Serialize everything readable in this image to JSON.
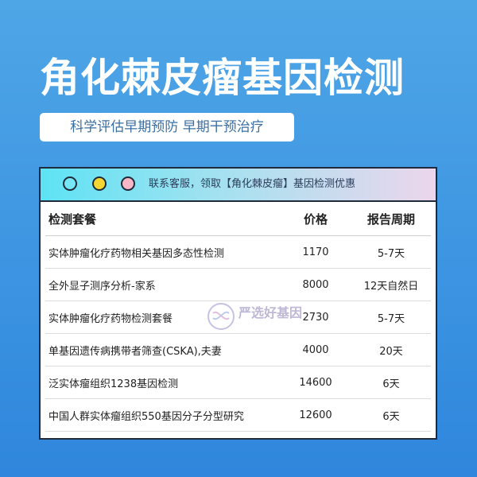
{
  "header": {
    "title": "角化棘皮瘤基因检测",
    "subtitle": "科学评估早期预防 早期干预治疗"
  },
  "window": {
    "bar_text": "联系客服，领取【角化棘皮瘤】基因检测优惠"
  },
  "table": {
    "columns": [
      "检测套餐",
      "价格",
      "报告周期"
    ],
    "rows": [
      {
        "name": "实体肿瘤化疗药物相关基因多态性检测",
        "price": "1170",
        "period": "5-7天"
      },
      {
        "name": "全外显子测序分析-家系",
        "price": "8000",
        "period": "12天自然日"
      },
      {
        "name": "实体肿瘤化疗药物检测套餐",
        "price": "2730",
        "period": "5-7天"
      },
      {
        "name": "单基因遗传病携带者筛查(CSKA),夫妻",
        "price": "4000",
        "period": "20天"
      },
      {
        "name": "泛实体瘤组织1238基因检测",
        "price": "14600",
        "period": "6天"
      },
      {
        "name": "中国人群实体瘤组织550基因分子分型研究",
        "price": "12600",
        "period": "6天"
      }
    ]
  },
  "watermark": {
    "text": "严选好基因"
  },
  "colors": {
    "background": "#3d95e2",
    "dot1": "#74e6f4",
    "dot2": "#f5d531",
    "dot3": "#f8b7c6"
  }
}
